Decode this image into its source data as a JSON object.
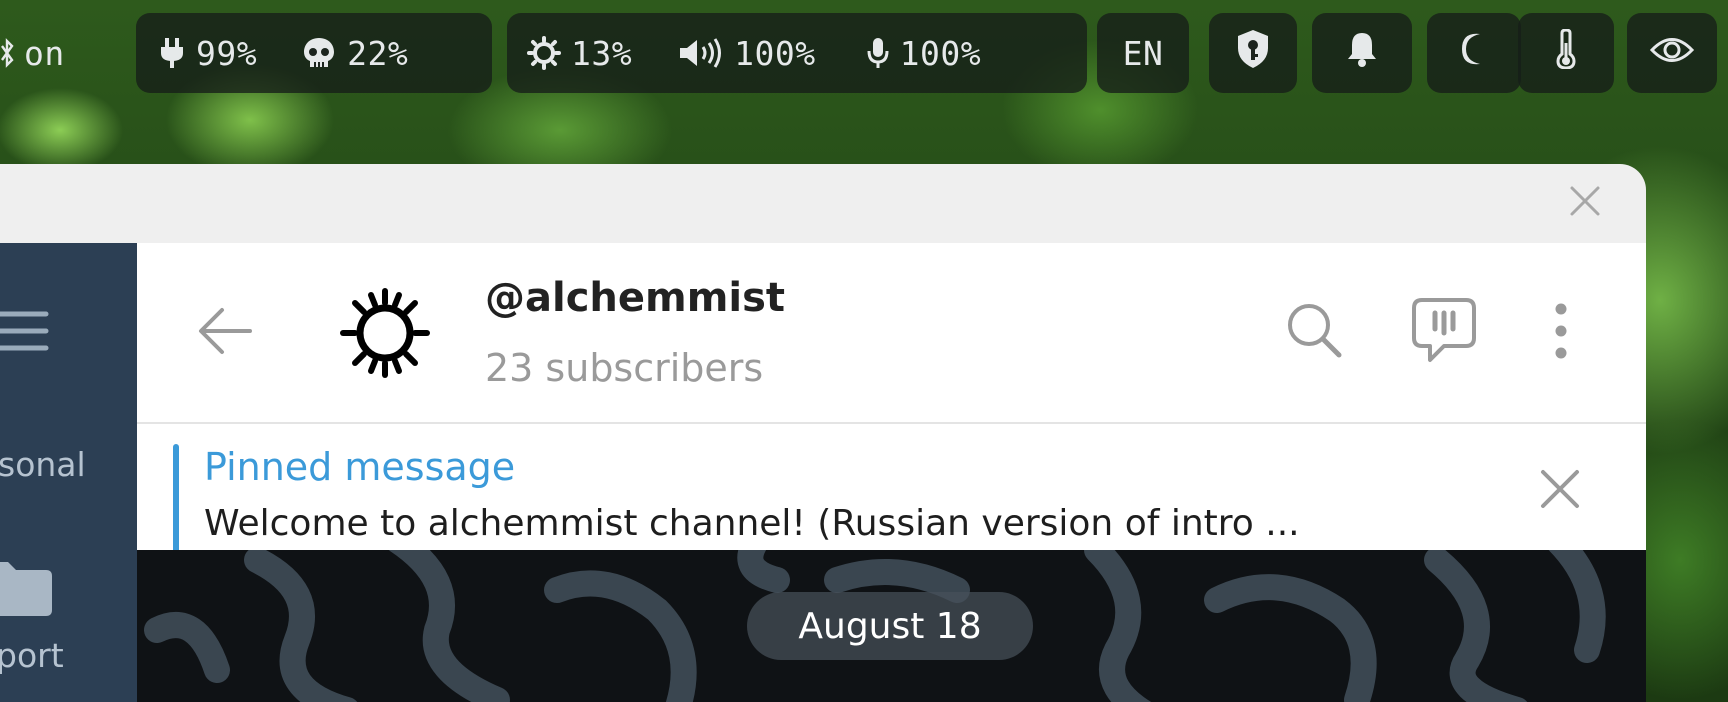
{
  "statusbar": {
    "bluetooth": {
      "icon": "bluetooth-icon",
      "value": "on"
    },
    "power": {
      "icon": "plug-icon",
      "value": "99%"
    },
    "memory": {
      "icon": "skull-icon",
      "value": "22%"
    },
    "brightness": {
      "icon": "brightness-icon",
      "value": "13%"
    },
    "volume": {
      "icon": "speaker-icon",
      "value": "100%"
    },
    "microphone": {
      "icon": "microphone-icon",
      "value": "100%"
    },
    "language": "EN",
    "icons": [
      "shield-key-icon",
      "bell-icon",
      "moon-icon",
      "thermometer-icon",
      "eye-icon"
    ]
  },
  "sidebar": {
    "menu_icon": "hamburger-menu-icon",
    "folders": [
      {
        "label": "sonal"
      },
      {
        "icon": "folder-icon",
        "label": "port"
      }
    ]
  },
  "chat": {
    "title": "@alchemmist",
    "subtitle": "23 subscribers",
    "avatar_icon": "sun-gear-icon",
    "actions": [
      "back-arrow-icon",
      "search-icon",
      "comments-icon",
      "more-vertical-icon"
    ]
  },
  "pinned": {
    "label": "Pinned message",
    "text": "Welcome to alchemmist channel!  (Russian version of intro ..."
  },
  "messages": {
    "date_separator": "August 18"
  },
  "colors": {
    "accent": "#3b9ad9",
    "sidebar_bg": "#2c3f54",
    "statusbar_pill": "#161e18"
  }
}
